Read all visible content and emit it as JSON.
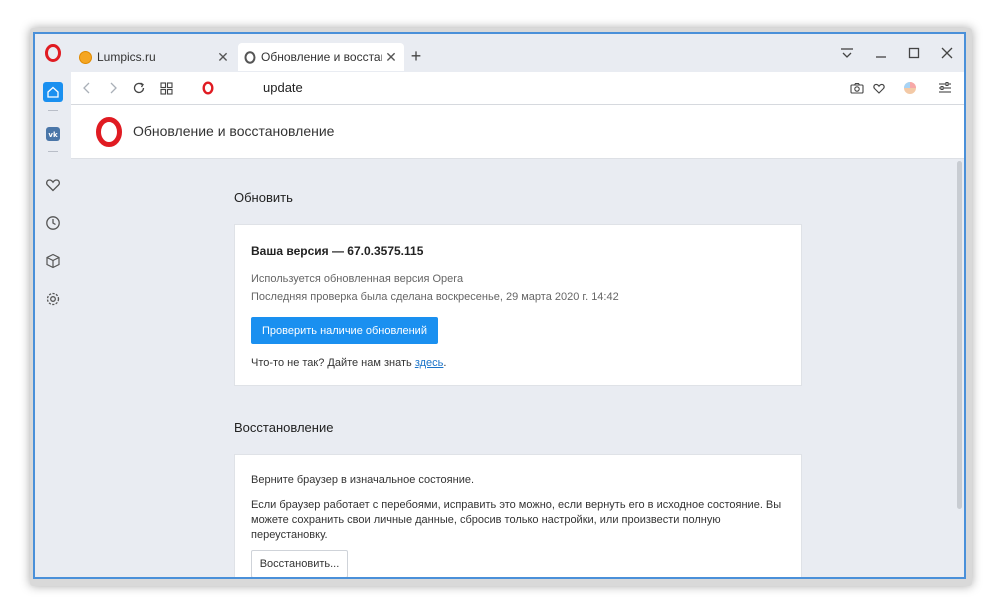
{
  "browser": {
    "tabs": [
      {
        "title": "Lumpics.ru",
        "active": false
      },
      {
        "title": "Обновление и восстановл",
        "active": true
      }
    ],
    "address": {
      "url": "update"
    }
  },
  "page": {
    "title": "Обновление и восстановление",
    "update": {
      "section_title": "Обновить",
      "version_label": "Ваша версия — 67.0.3575.115",
      "status": "Используется обновленная версия Opera",
      "last_check": "Последняя проверка была сделана воскресенье, 29 марта 2020 г. 14:42",
      "check_button": "Проверить наличие обновлений",
      "feedback_text": "Что-то не так? Дайте нам знать ",
      "feedback_link": "здесь",
      "feedback_end": "."
    },
    "recovery": {
      "section_title": "Восстановление",
      "intro": "Верните браузер в изначальное состояние.",
      "description": "Если браузер работает с перебоями, исправить это можно, если вернуть его в исходное состояние. Вы можете сохранить свои личные данные, сбросив только настройки, или произвести полную переустановку.",
      "restore_button": "Восстановить..."
    }
  },
  "colors": {
    "accent": "#1a90f0",
    "opera_red": "#e01b22",
    "window_border": "#4a90d9"
  }
}
